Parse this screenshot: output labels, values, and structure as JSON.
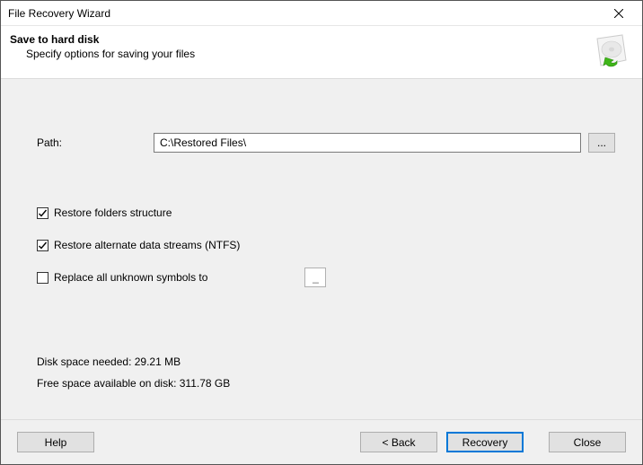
{
  "window": {
    "title": "File Recovery Wizard"
  },
  "header": {
    "title": "Save to hard disk",
    "subtitle": "Specify options for saving your files"
  },
  "path": {
    "label": "Path:",
    "value": "C:\\Restored Files\\",
    "browse": "..."
  },
  "options": {
    "restore_folders": {
      "label": "Restore folders structure",
      "checked": true
    },
    "restore_ads": {
      "label": "Restore alternate data streams (NTFS)",
      "checked": true
    },
    "replace_symbols": {
      "label": "Replace all unknown symbols to",
      "checked": false,
      "value": "_"
    }
  },
  "stats": {
    "needed": "Disk space needed: 29.21 MB",
    "free": "Free space available on disk: 311.78 GB"
  },
  "footer": {
    "help": "Help",
    "back": "< Back",
    "recovery": "Recovery",
    "close": "Close"
  }
}
